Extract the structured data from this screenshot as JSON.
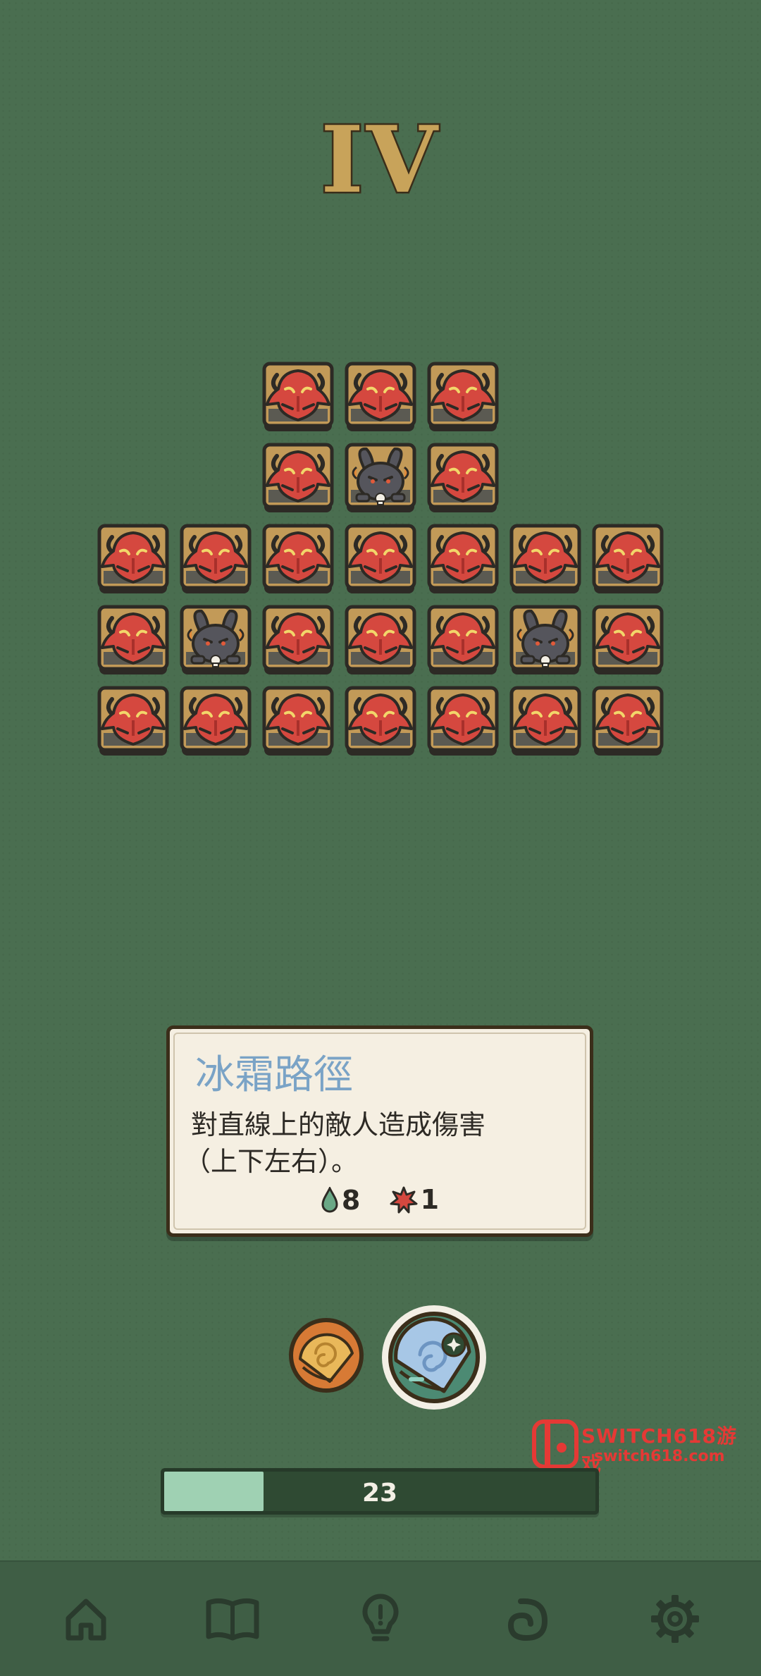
{
  "level": {
    "numeral": "IV"
  },
  "board": {
    "rows": [
      {
        "tiles": [
          "demon",
          "demon",
          "demon"
        ]
      },
      {
        "tiles": [
          "demon",
          "rabbit",
          "demon"
        ]
      },
      {
        "tiles": [
          "demon",
          "demon",
          "demon",
          "demon",
          "demon",
          "demon",
          "demon"
        ]
      },
      {
        "tiles": [
          "demon",
          "rabbit",
          "demon",
          "demon",
          "demon",
          "rabbit",
          "demon"
        ]
      },
      {
        "tiles": [
          "demon",
          "demon",
          "demon",
          "demon",
          "demon",
          "demon",
          "demon"
        ]
      }
    ]
  },
  "card": {
    "title": "冰霜路徑",
    "description_line1": "對直線上的敵人造成傷害",
    "description_line2": "（上下左右）。",
    "stat_drop_icon": "water-drop-icon",
    "stat_drop_value": "8",
    "stat_damage_icon": "damage-burst-icon",
    "stat_damage_value": "1"
  },
  "spells": [
    {
      "name": "fire-spell-orb",
      "selected": false
    },
    {
      "name": "frost-spell-orb",
      "selected": true
    }
  ],
  "progress": {
    "label": "23",
    "fill_fraction": 0.23
  },
  "watermark": {
    "line1": "SWITCH618游戏",
    "line2": "switch618.com"
  },
  "nav": [
    {
      "icon": "home-icon"
    },
    {
      "icon": "book-icon"
    },
    {
      "icon": "lightbulb-icon"
    },
    {
      "icon": "swirl-icon"
    },
    {
      "icon": "gear-icon"
    }
  ],
  "colors": {
    "background": "#4a6e50",
    "tile_frame": "#c29a58",
    "demon_red": "#d5483f",
    "card_title": "#7aa3c6",
    "progress_fill": "#9fd1b3"
  }
}
